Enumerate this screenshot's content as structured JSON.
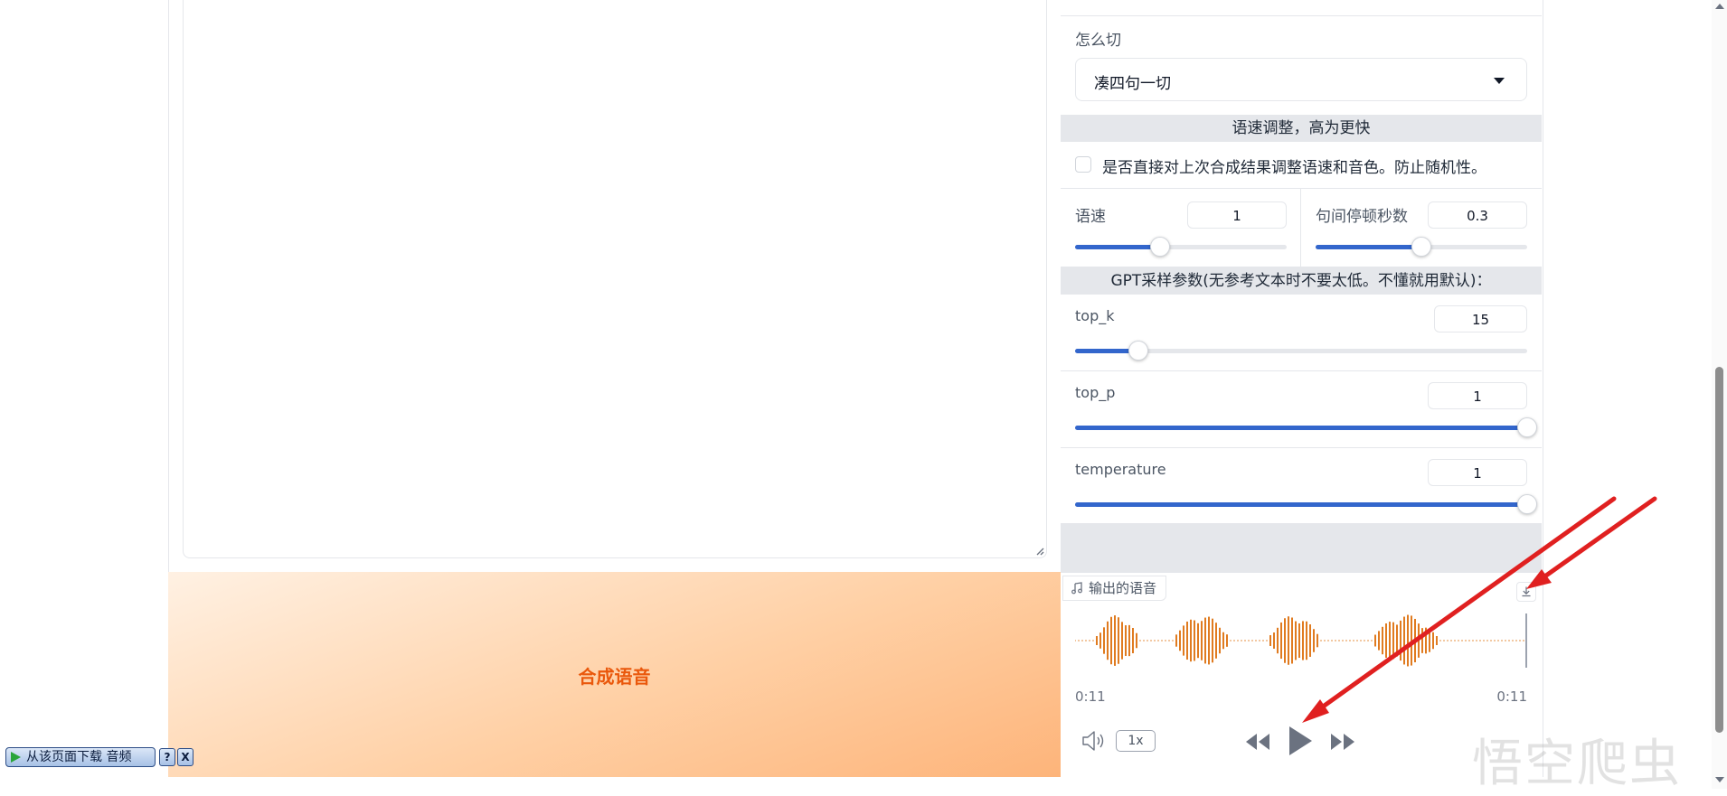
{
  "settings": {
    "split_label": "怎么切",
    "split_value": "凑四句一切",
    "speed_section_title": "语速调整，高为更快",
    "same_checkbox_label": "是否直接对上次合成结果调整语速和音色。防止随机性。",
    "speed": {
      "label": "语速",
      "value": "1",
      "level": 0.4
    },
    "pause": {
      "label": "句间停顿秒数",
      "value": "0.3",
      "level": 0.5
    },
    "gpt_section_title": "GPT采样参数(无参考文本时不要太低。不懂就用默认)：",
    "top_k": {
      "label": "top_k",
      "value": "15",
      "level": 0.14
    },
    "top_p": {
      "label": "top_p",
      "value": "1",
      "level": 1.0
    },
    "temperature": {
      "label": "temperature",
      "value": "1",
      "level": 1.0
    }
  },
  "synthesize": {
    "label": "合成语音"
  },
  "audio": {
    "label": "输出的语音",
    "current_time": "0:11",
    "duration": "0:11",
    "playback_rate": "1x"
  },
  "helper_toolbar": {
    "download_label": "从该页面下载 音频",
    "help_label": "?",
    "close_label": "X"
  },
  "watermark": {
    "text": "悟空爬虫"
  },
  "colors": {
    "accent": "#3366cc",
    "synthesize_text": "#ea580c",
    "waveform": "#e07b20",
    "annotation_arrow": "#e02020"
  }
}
